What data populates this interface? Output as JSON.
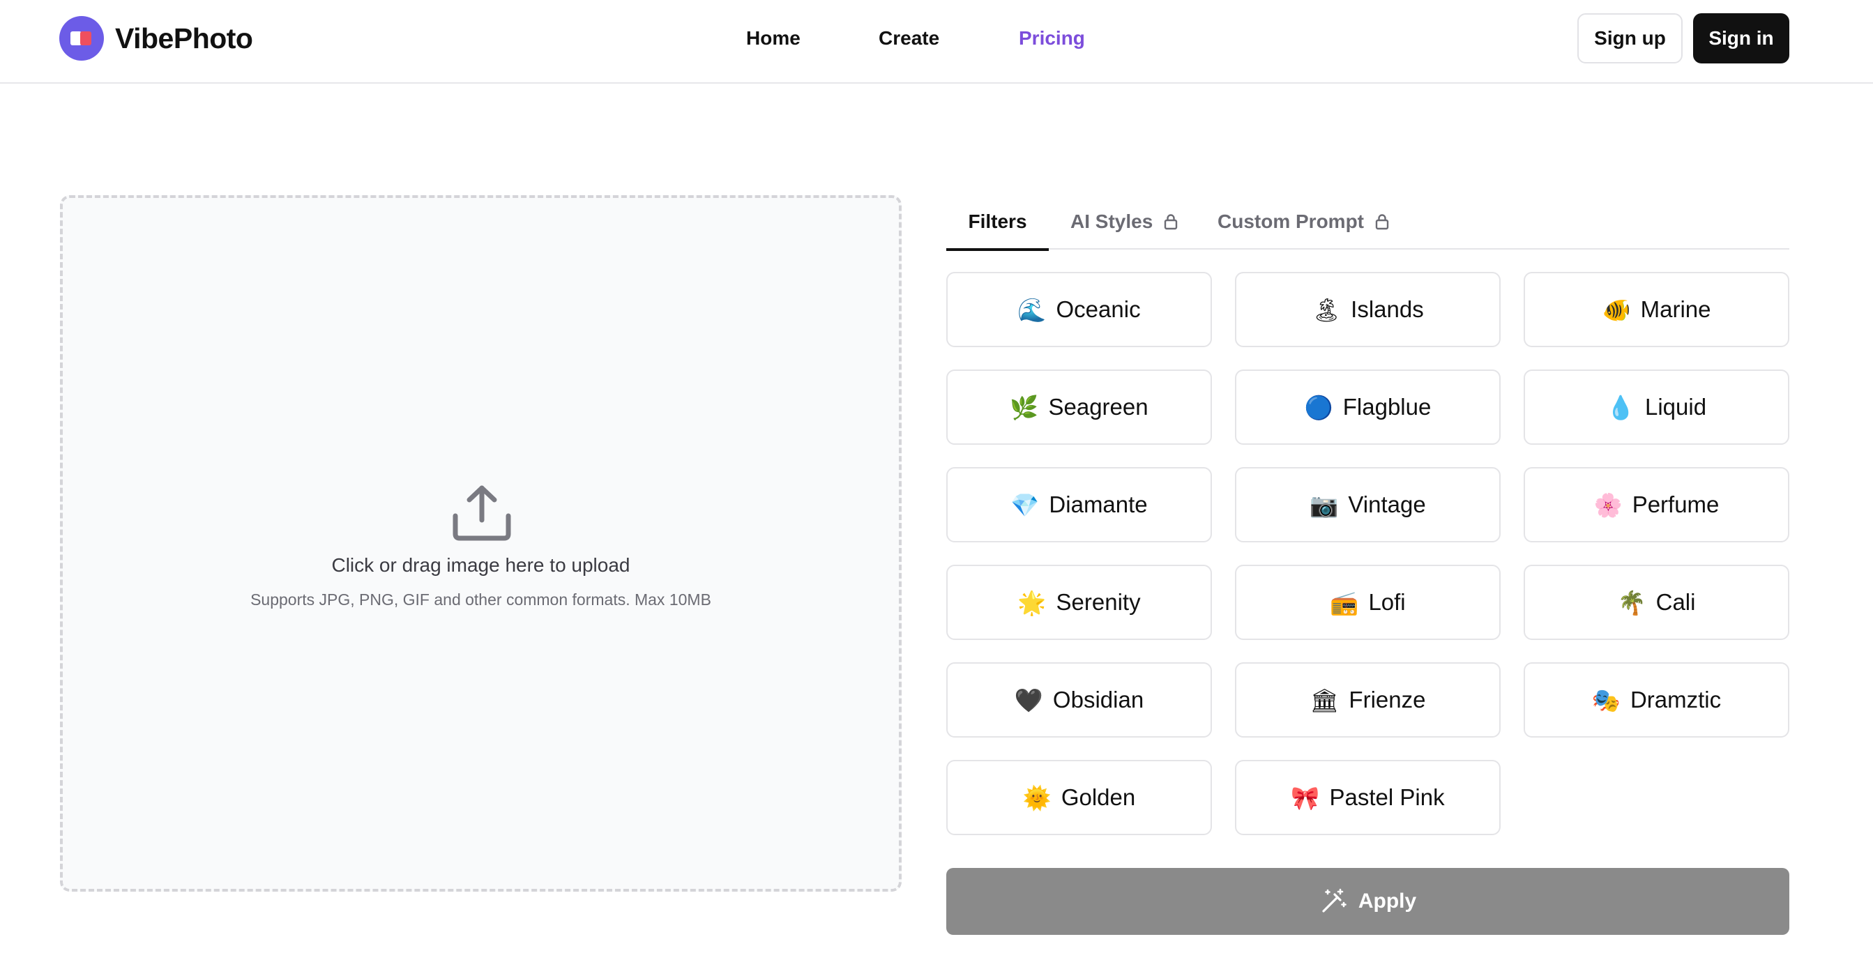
{
  "header": {
    "brand": "VibePhoto",
    "nav": [
      {
        "label": "Home",
        "active": false
      },
      {
        "label": "Create",
        "active": false
      },
      {
        "label": "Pricing",
        "active": true
      }
    ],
    "signup_label": "Sign up",
    "signin_label": "Sign in"
  },
  "upload": {
    "title": "Click or drag image here to upload",
    "subtitle": "Supports JPG, PNG, GIF and other common formats. Max 10MB"
  },
  "tabs": [
    {
      "label": "Filters",
      "active": true,
      "locked": false
    },
    {
      "label": "AI Styles",
      "active": false,
      "locked": true
    },
    {
      "label": "Custom Prompt",
      "active": false,
      "locked": true
    }
  ],
  "filters": [
    {
      "emoji": "🌊",
      "label": "Oceanic"
    },
    {
      "emoji": "🏝",
      "label": "Islands"
    },
    {
      "emoji": "🐠",
      "label": "Marine"
    },
    {
      "emoji": "🌿",
      "label": "Seagreen"
    },
    {
      "emoji": "🔵",
      "label": "Flagblue"
    },
    {
      "emoji": "💧",
      "label": "Liquid"
    },
    {
      "emoji": "💎",
      "label": "Diamante"
    },
    {
      "emoji": "📷",
      "label": "Vintage"
    },
    {
      "emoji": "🌸",
      "label": "Perfume"
    },
    {
      "emoji": "🌟",
      "label": "Serenity"
    },
    {
      "emoji": "📻",
      "label": "Lofi"
    },
    {
      "emoji": "🌴",
      "label": "Cali"
    },
    {
      "emoji": "🖤",
      "label": "Obsidian"
    },
    {
      "emoji": "🏛",
      "label": "Frienze"
    },
    {
      "emoji": "🎭",
      "label": "Dramztic"
    },
    {
      "emoji": "🌞",
      "label": "Golden"
    },
    {
      "emoji": "🎀",
      "label": "Pastel Pink"
    }
  ],
  "apply_label": "Apply",
  "colors": {
    "accent": "#7c4ddb",
    "logo": "#6c5ce7",
    "apply_disabled": "#8a8a8a",
    "dark_button": "#111111"
  }
}
